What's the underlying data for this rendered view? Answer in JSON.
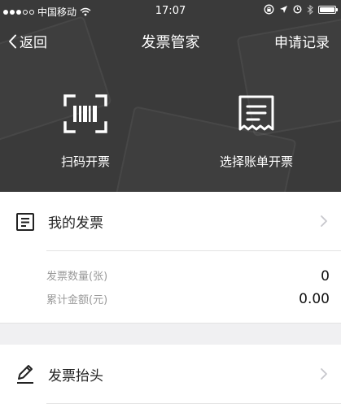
{
  "status_bar": {
    "carrier": "中国移动",
    "time": "17:07"
  },
  "nav": {
    "back_label": "返回",
    "title": "发票管家",
    "right_link": "申请记录"
  },
  "actions": [
    {
      "label": "扫码开票",
      "icon": "barcode-scan-icon"
    },
    {
      "label": "选择账单开票",
      "icon": "bill-receipt-icon"
    }
  ],
  "my_invoices": {
    "title": "我的发票",
    "icon": "invoice-list-icon",
    "stats": [
      {
        "label": "发票数量(张)",
        "value": "0"
      },
      {
        "label": "累计金额(元)",
        "value": "0.00"
      }
    ]
  },
  "invoice_header": {
    "title": "发票抬头",
    "icon": "pencil-edit-icon"
  },
  "colors": {
    "header_bg": "#3a3a3a",
    "text_primary": "#222222",
    "text_secondary": "#9a9a9a",
    "divider": "#e3e3e3",
    "section_gap": "#f0f0f2"
  }
}
